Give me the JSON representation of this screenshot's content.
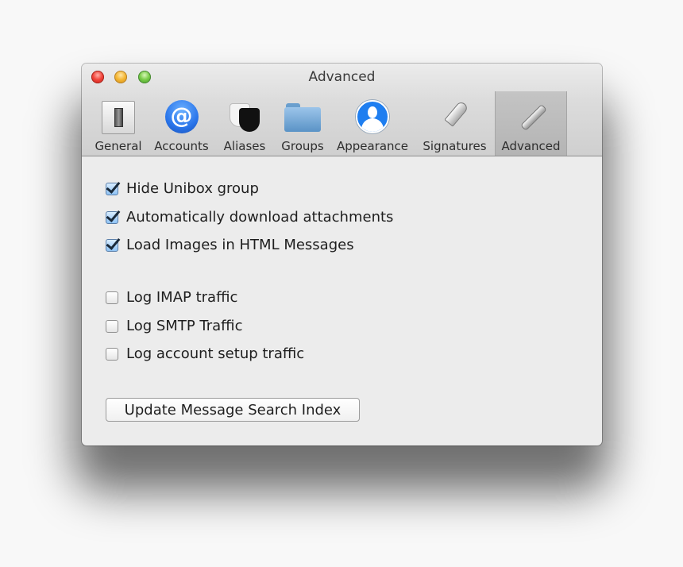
{
  "window": {
    "title": "Advanced",
    "traffic_lights": [
      "close",
      "minimize",
      "zoom"
    ]
  },
  "toolbar": {
    "items": [
      {
        "label": "General",
        "icon": "light-switch-icon",
        "active": false
      },
      {
        "label": "Accounts",
        "icon": "at-sign-icon",
        "active": false
      },
      {
        "label": "Aliases",
        "icon": "theater-masks-icon",
        "active": false
      },
      {
        "label": "Groups",
        "icon": "folder-icon",
        "active": false
      },
      {
        "label": "Appearance",
        "icon": "user-silhouette-icon",
        "active": false
      },
      {
        "label": "Signatures",
        "icon": "fountain-pen-icon",
        "active": false
      },
      {
        "label": "Advanced",
        "icon": "wrench-icon",
        "active": true
      }
    ]
  },
  "settings": {
    "checkboxes": [
      {
        "label": "Hide Unibox group",
        "checked": true
      },
      {
        "label": "Automatically download attachments",
        "checked": true
      },
      {
        "label": "Load Images in HTML Messages",
        "checked": true
      },
      {
        "label": "Log IMAP traffic",
        "checked": false
      },
      {
        "label": "Log SMTP Traffic",
        "checked": false
      },
      {
        "label": "Log account setup traffic",
        "checked": false
      }
    ],
    "update_button_label": "Update Message Search Index"
  },
  "colors": {
    "window_bg": "#ececec",
    "checkbox_checked": "#8fc3f5",
    "close": "#f2443a",
    "minimize": "#f4b634",
    "zoom": "#79cc48"
  }
}
